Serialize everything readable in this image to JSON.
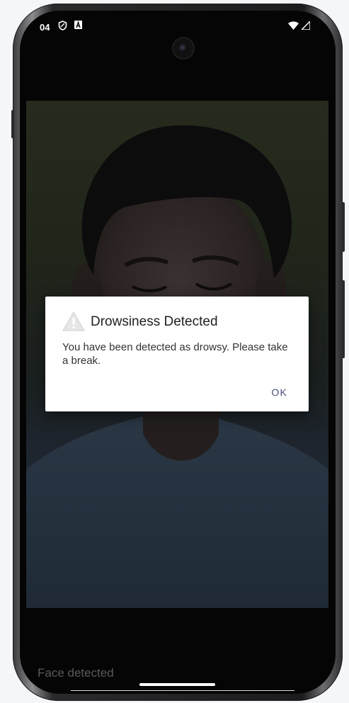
{
  "status_bar": {
    "time": "04",
    "left_icons": [
      "shield-icon",
      "a-badge-icon"
    ],
    "right_icons": [
      "wifi-icon",
      "signal-icon"
    ]
  },
  "dialog": {
    "title": "Drowsiness Detected",
    "message": "You have been detected as drowsy. Please take a break.",
    "ok_label": "OK",
    "icon": "warning-icon"
  },
  "footer": {
    "status_text": "Face detected"
  },
  "colors": {
    "dialog_bg": "#ffffff",
    "ok_text": "#4a4e7a",
    "screen_bg": "#050505"
  }
}
